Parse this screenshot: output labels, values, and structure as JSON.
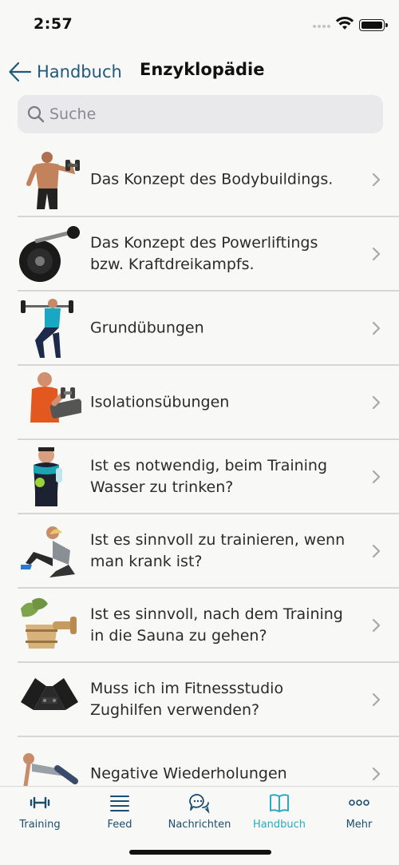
{
  "status_bar": {
    "time": "2:57"
  },
  "nav": {
    "back_label": "Handbuch",
    "title": "Enzyklopädie"
  },
  "search": {
    "placeholder": "Suche"
  },
  "list": {
    "items": [
      {
        "label": "Das Konzept des Bodybuildings.",
        "icon": "bodybuilder-image"
      },
      {
        "label": "Das Konzept des Powerliftings bzw. Kraftdreikampfs.",
        "icon": "barbell-image"
      },
      {
        "label": "Grundübungen",
        "icon": "squat-image"
      },
      {
        "label": "Isolationsübungen",
        "icon": "curl-image"
      },
      {
        "label": "Ist es notwendig, beim Training Wasser zu trinken?",
        "icon": "water-bottle-image"
      },
      {
        "label": "Ist es sinnvoll zu trainieren, wenn man krank ist?",
        "icon": "sick-athlete-image"
      },
      {
        "label": "Ist es sinnvoll, nach dem Training in die Sauna zu gehen?",
        "icon": "sauna-image"
      },
      {
        "label": "Muss ich im Fitnessstudio Zughilfen verwenden?",
        "icon": "lifting-straps-image"
      },
      {
        "label": "Negative Wiederholungen",
        "icon": "pushup-image"
      }
    ]
  },
  "tabs": [
    {
      "label": "Training",
      "icon": "dumbbell-icon",
      "active": false
    },
    {
      "label": "Feed",
      "icon": "feed-lines-icon",
      "active": false
    },
    {
      "label": "Nachrichten",
      "icon": "chat-bubbles-icon",
      "active": false
    },
    {
      "label": "Handbuch",
      "icon": "book-icon",
      "active": true
    },
    {
      "label": "Mehr",
      "icon": "more-dots-icon",
      "active": false
    }
  ],
  "colors": {
    "accent": "#2aa9bf",
    "tab_inactive": "#1a4e6e",
    "back": "#1f5a7a"
  }
}
